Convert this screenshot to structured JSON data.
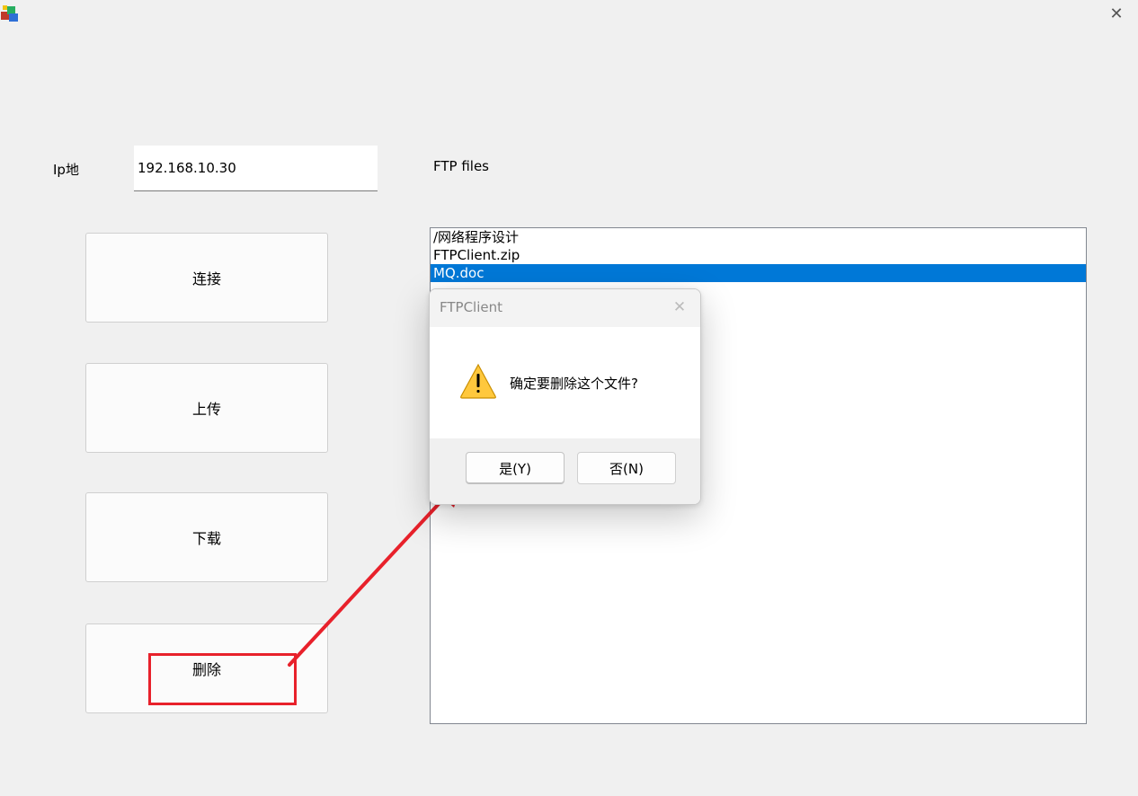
{
  "window": {
    "close_glyph": "✕"
  },
  "form": {
    "ip_label": "Ip地",
    "ip_value": "192.168.10.30",
    "ftp_files_label": "FTP files"
  },
  "buttons": {
    "connect": "连接",
    "upload": "上传",
    "download": "下载",
    "delete": "删除"
  },
  "file_list": [
    "/网络程序设计",
    "FTPClient.zip",
    "MQ.doc"
  ],
  "selected_index": 2,
  "dialog": {
    "title": "FTPClient",
    "message": "确定要删除这个文件?",
    "yes_label": "是(Y)",
    "no_label": "否(N)",
    "icon": "warning-icon"
  },
  "annotation": {
    "color": "#e8212b"
  },
  "colors": {
    "selection": "#0078d7"
  }
}
